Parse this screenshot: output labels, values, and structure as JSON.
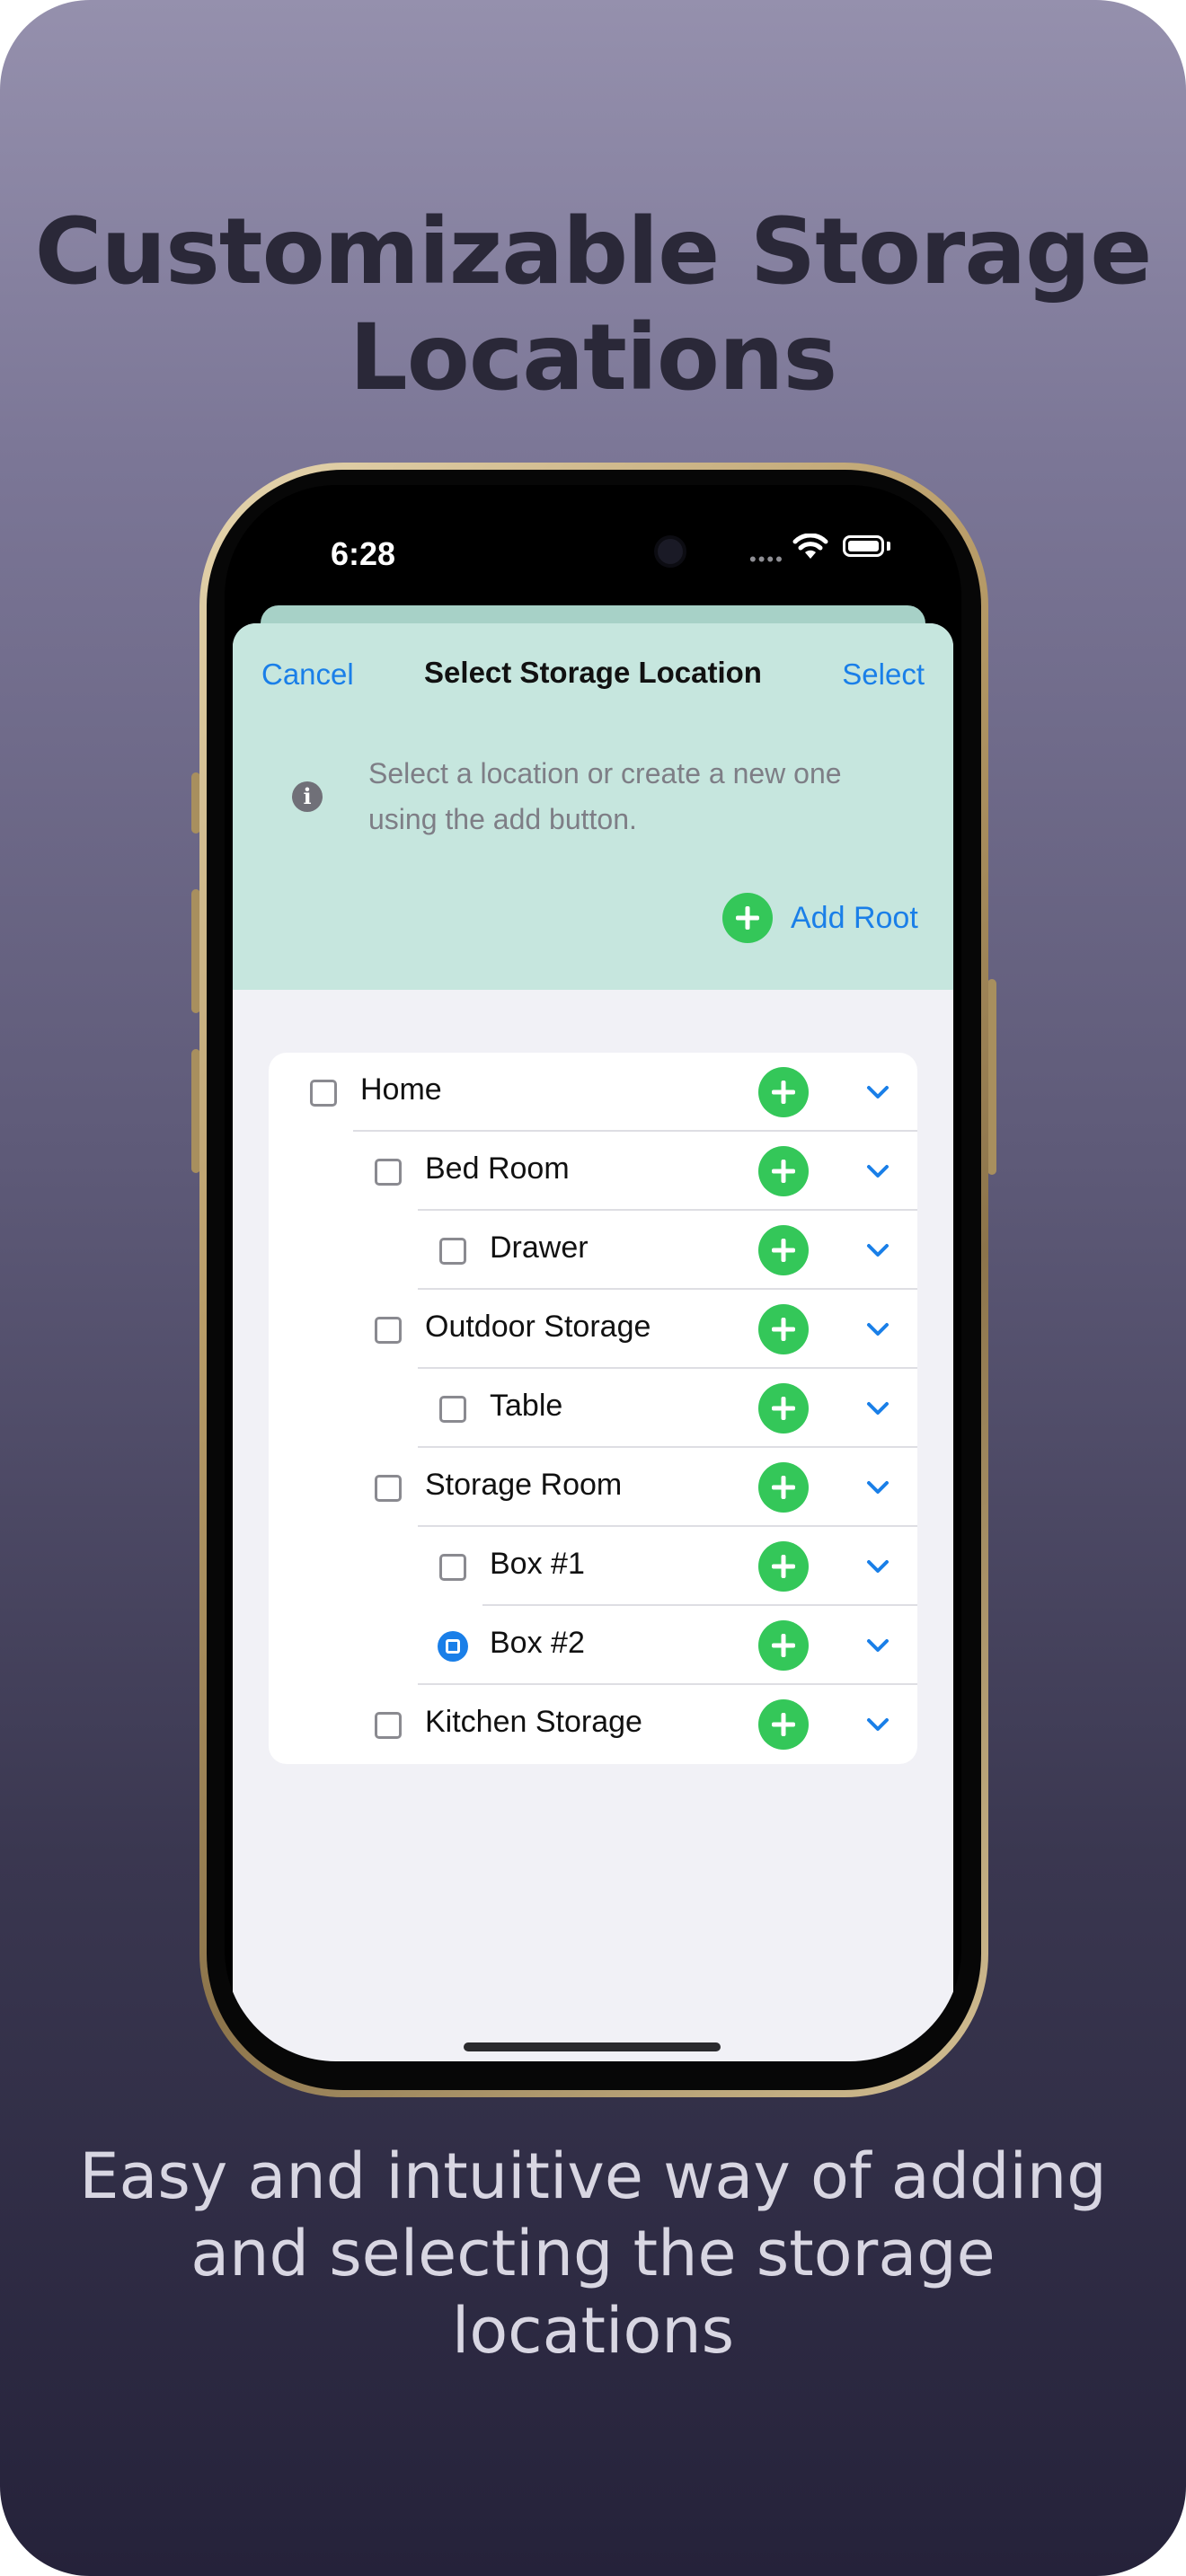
{
  "headline": "Customizable Storage Locations",
  "subheadline": "Easy and intuitive way of adding and selecting the storage locations",
  "status_bar": {
    "time": "6:28",
    "signal_icon": "cellular-dots-icon",
    "wifi_icon": "wifi-icon",
    "battery_icon": "battery-icon"
  },
  "nav": {
    "cancel_label": "Cancel",
    "title": "Select Storage Location",
    "select_label": "Select"
  },
  "info": {
    "icon": "info-icon",
    "text": "Select a location or create a new one using the add button."
  },
  "add_root_label": "Add Root",
  "locations": [
    {
      "label": "Home",
      "level": 0,
      "selected": false
    },
    {
      "label": "Bed Room",
      "level": 1,
      "selected": false
    },
    {
      "label": "Drawer",
      "level": 2,
      "selected": false
    },
    {
      "label": "Outdoor Storage",
      "level": 1,
      "selected": false
    },
    {
      "label": "Table",
      "level": 2,
      "selected": false
    },
    {
      "label": "Storage Room",
      "level": 1,
      "selected": false
    },
    {
      "label": "Box #1",
      "level": 2,
      "selected": false
    },
    {
      "label": "Box #2",
      "level": 2,
      "selected": true
    },
    {
      "label": "Kitchen Storage",
      "level": 1,
      "selected": false
    }
  ],
  "colors": {
    "accent": "#1a7fe8",
    "add_green": "#34c759",
    "header_tint": "#c6e6de"
  }
}
